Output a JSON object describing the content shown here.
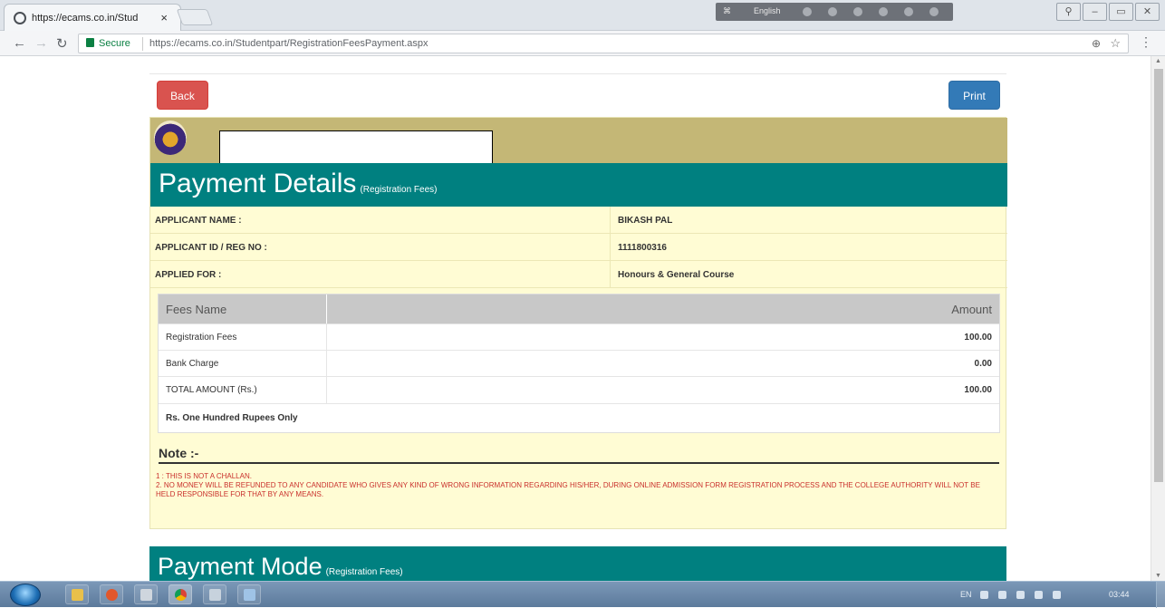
{
  "browser": {
    "tab_title": "https://ecams.co.in/Stud",
    "tab_close": "×",
    "secure_label": "Secure",
    "url": "https://ecams.co.in/Studentpart/RegistrationFeesPayment.aspx",
    "ime_label": "English"
  },
  "page": {
    "back_label": "Back",
    "print_label": "Print",
    "payment_details": {
      "title": "Payment Details",
      "subtitle": "(Registration Fees)"
    },
    "applicant": [
      {
        "label": "APPLICANT NAME :",
        "value": "BIKASH PAL"
      },
      {
        "label": "APPLICANT ID / REG NO :",
        "value": "1111800316"
      },
      {
        "label": "APPLIED FOR :",
        "value": "Honours & General Course"
      }
    ],
    "fees_table": {
      "headers": [
        "Fees Name",
        "Amount"
      ],
      "rows": [
        {
          "name": "Registration Fees",
          "amount": "100.00"
        },
        {
          "name": "Bank Charge",
          "amount": "0.00"
        },
        {
          "name": "TOTAL AMOUNT (Rs.)",
          "amount": "100.00"
        }
      ],
      "amount_words": "Rs. One Hundred Rupees Only"
    },
    "note": {
      "title": "Note :-",
      "items": [
        "1 : THIS IS NOT A CHALLAN.",
        "2.  NO MONEY WILL BE REFUNDED TO ANY CANDIDATE WHO GIVES ANY KIND OF WRONG INFORMATION REGARDING HIS/HER, DURING ONLINE ADMISSION FORM REGISTRATION PROCESS AND THE COLLEGE AUTHORITY WILL NOT BE HELD RESPONSIBLE FOR THAT BY ANY MEANS."
      ]
    },
    "payment_mode": {
      "title": "Payment Mode",
      "subtitle": "(Registration Fees)"
    }
  },
  "taskbar": {
    "language": "EN",
    "clock": "03:44"
  },
  "colors": {
    "teal": "#008080",
    "back_red": "#d9534f",
    "print_blue": "#337ab7",
    "panel_yellow": "#fffcd4",
    "brand_olive": "#c4b776",
    "note_red": "#c9302c"
  }
}
